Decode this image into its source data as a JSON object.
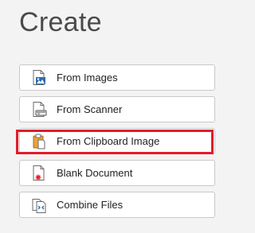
{
  "header": {
    "title": "Create"
  },
  "options": [
    {
      "label": "From Images",
      "icon": "image-file-icon"
    },
    {
      "label": "From Scanner",
      "icon": "scanner-file-icon"
    },
    {
      "label": "From Clipboard Image",
      "icon": "clipboard-icon"
    },
    {
      "label": "Blank Document",
      "icon": "blank-document-icon"
    },
    {
      "label": "Combine Files",
      "icon": "combine-files-icon"
    }
  ],
  "colors": {
    "highlight": "#e01c2a",
    "background": "#f3f3f3",
    "icon_blue": "#2b6cb3",
    "icon_orange": "#e8a33d"
  }
}
